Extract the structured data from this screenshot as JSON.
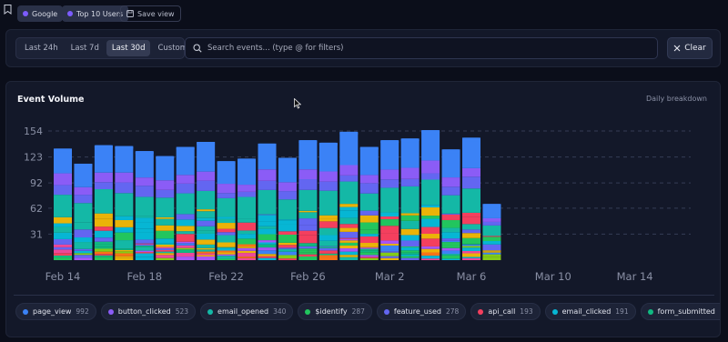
{
  "saved_views": {
    "chips": [
      {
        "label": "Google",
        "color": "#7c5cff"
      },
      {
        "label": "Top 10 Users",
        "color": "#7c5cff"
      }
    ],
    "save_label": "Save view"
  },
  "filters": {
    "ranges": [
      "Last 24h",
      "Last 7d",
      "Last 30d",
      "Custom"
    ],
    "active_range": "Last 30d",
    "search_placeholder": "Search events... (type @ for filters)",
    "search_value": "",
    "clear_label": "Clear"
  },
  "chart": {
    "title": "Event Volume",
    "subtitle": "Daily breakdown"
  },
  "chart_data": {
    "type": "bar",
    "stacked": true,
    "yticks": [
      31,
      62,
      92,
      123,
      154
    ],
    "ylim": [
      0,
      154
    ],
    "xticks": [
      "Feb 14",
      "Feb 18",
      "Feb 22",
      "Feb 26",
      "Mar 2",
      "Mar 6",
      "Mar 10",
      "Mar 14"
    ],
    "categories": [
      "Feb 14",
      "Feb 15",
      "Feb 16",
      "Feb 17",
      "Feb 18",
      "Feb 19",
      "Feb 20",
      "Feb 21",
      "Feb 22",
      "Feb 23",
      "Feb 24",
      "Feb 25",
      "Feb 26",
      "Feb 27",
      "Feb 28",
      "Mar 1",
      "Mar 2",
      "Mar 3",
      "Mar 4",
      "Mar 5",
      "Mar 6",
      "Mar 7",
      "Mar 8",
      "Mar 9",
      "Mar 10",
      "Mar 11",
      "Mar 12",
      "Mar 13",
      "Mar 14",
      "Mar 15"
    ],
    "totals": [
      133,
      115,
      137,
      136,
      130,
      124,
      135,
      141,
      118,
      121,
      139,
      122,
      143,
      140,
      153,
      135,
      143,
      145,
      155,
      132,
      146,
      67,
      0,
      0,
      0,
      0,
      0,
      0,
      0,
      0
    ],
    "grid": true,
    "series": [
      {
        "name": "page_view",
        "color": "#3b82f6",
        "total": 992
      },
      {
        "name": "button_clicked",
        "color": "#8b5cf6",
        "total": 523
      },
      {
        "name": "email_opened",
        "color": "#14b8a6",
        "total": 340
      },
      {
        "name": "$identify",
        "color": "#22c55e",
        "total": 287
      },
      {
        "name": "feature_used",
        "color": "#6366f1",
        "total": 278
      },
      {
        "name": "api_call",
        "color": "#f43f5e",
        "total": 193
      },
      {
        "name": "email_clicked",
        "color": "#06b6d4",
        "total": 191
      },
      {
        "name": "form_submitted",
        "color": "#10b981",
        "total": 165
      }
    ]
  }
}
